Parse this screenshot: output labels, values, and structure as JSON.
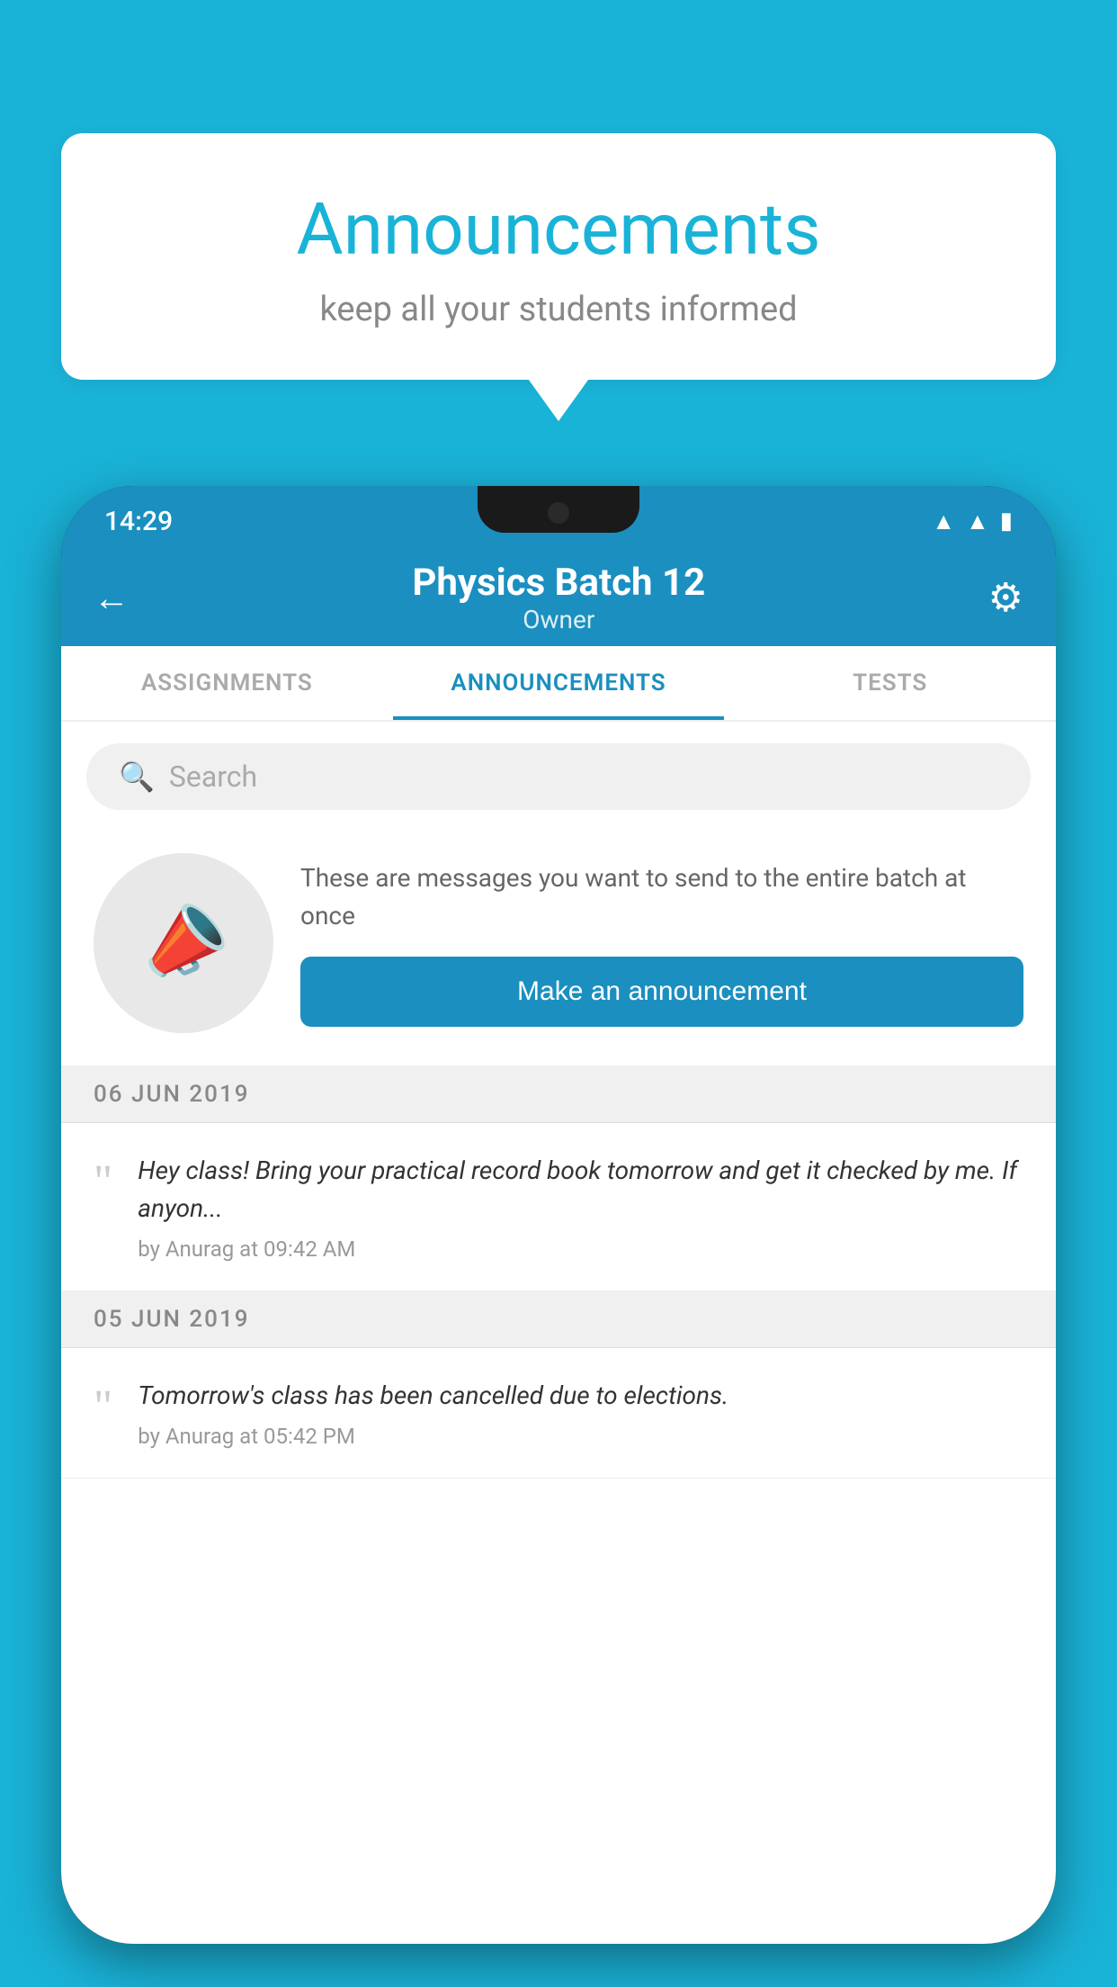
{
  "background_color": "#1ab3d8",
  "bubble": {
    "title": "Announcements",
    "subtitle": "keep all your students informed"
  },
  "status_bar": {
    "time": "14:29",
    "icons": [
      "wifi",
      "signal",
      "battery"
    ]
  },
  "header": {
    "title": "Physics Batch 12",
    "subtitle": "Owner",
    "back_label": "←",
    "settings_label": "⚙"
  },
  "tabs": [
    {
      "label": "ASSIGNMENTS",
      "active": false
    },
    {
      "label": "ANNOUNCEMENTS",
      "active": true
    },
    {
      "label": "TESTS",
      "active": false
    }
  ],
  "search": {
    "placeholder": "Search"
  },
  "promo": {
    "description": "These are messages you want to send to the entire batch at once",
    "button_label": "Make an announcement"
  },
  "date_sections": [
    {
      "date": "06  JUN  2019",
      "announcements": [
        {
          "text": "Hey class! Bring your practical record book tomorrow and get it checked by me. If anyon...",
          "meta": "by Anurag at 09:42 AM"
        }
      ]
    },
    {
      "date": "05  JUN  2019",
      "announcements": [
        {
          "text": "Tomorrow's class has been cancelled due to elections.",
          "meta": "by Anurag at 05:42 PM"
        }
      ]
    }
  ]
}
